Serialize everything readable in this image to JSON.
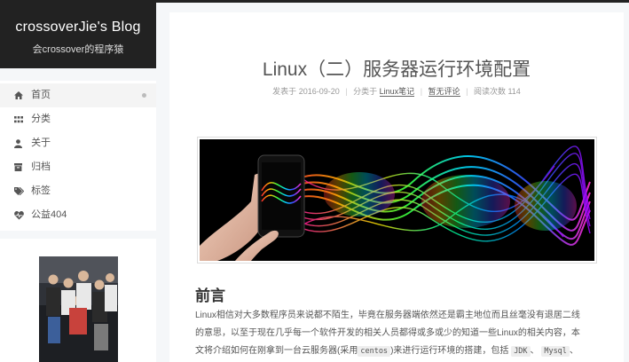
{
  "blog": {
    "title": "crossoverJie's Blog",
    "subtitle": "会crossover的程序猿"
  },
  "menu": [
    {
      "label": "首页",
      "icon": "home-icon",
      "active": true
    },
    {
      "label": "分类",
      "icon": "grid-icon"
    },
    {
      "label": "关于",
      "icon": "user-icon"
    },
    {
      "label": "归档",
      "icon": "archive-icon"
    },
    {
      "label": "标签",
      "icon": "tags-icon"
    },
    {
      "label": "公益404",
      "icon": "heartbeat-icon"
    }
  ],
  "post": {
    "title": "Linux（二）服务器运行环境配置",
    "meta": {
      "published_prefix": "发表于",
      "date": "2016-09-20",
      "category_prefix": "分类于",
      "category": "Linux笔记",
      "comment": "暂无评论",
      "read_prefix": "阅读次数",
      "read_count": "114"
    },
    "section_title": "前言",
    "paragraph_lines": [
      "Linux相信对大多数程序员来说都不陌生，毕竟在服务器端依然还是霸主地位而且丝毫没有退居二线",
      "的意思，以至于现在几乎每一个软件开发的相关人员都得或多或少的知道一些Linux的相关内容，本"
    ],
    "paragraph_line3": {
      "before": "文将介绍如何在刚拿到一台云服务器(采用",
      "code1": "centos",
      "middle": ")来进行运行环境的搭建，包括",
      "code2": "JDK",
      "sep1": "、",
      "code3": "Mysql",
      "sep2": "、"
    }
  },
  "colors": {
    "brand_bg": "#222222",
    "page_bg": "#f5f7f9"
  }
}
